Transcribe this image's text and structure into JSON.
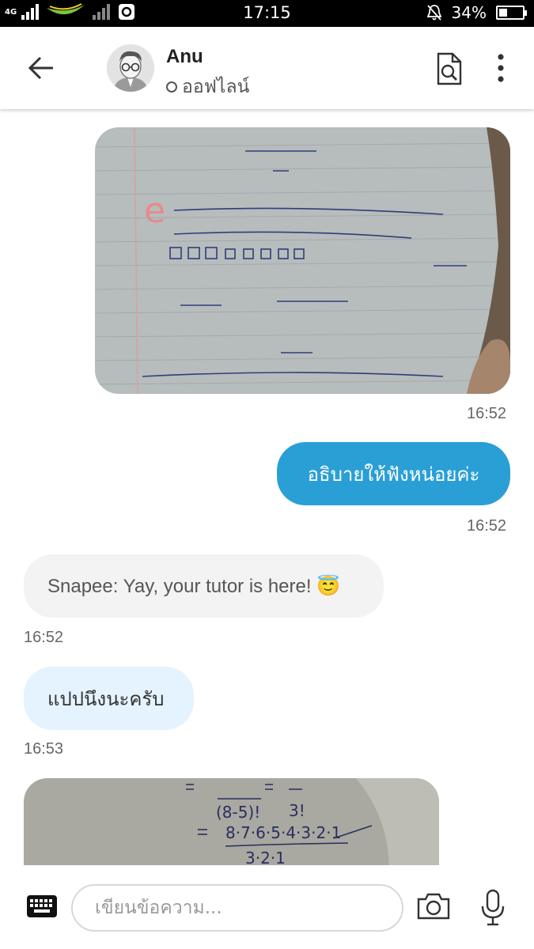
{
  "status_bar": {
    "network_type": "4G",
    "time": "17:15",
    "battery": "34%",
    "battery_level": 0.34
  },
  "header": {
    "back_icon": "arrow-left-icon",
    "contact_name": "Anu",
    "contact_status": "ออฟไลน์",
    "search_icon": "document-search-icon",
    "more_icon": "more-vertical-icon"
  },
  "messages": [
    {
      "type": "image",
      "direction": "outgoing",
      "time": "16:52"
    },
    {
      "type": "text",
      "direction": "outgoing",
      "text": "อธิบายให้ฟังหน่อยค่ะ",
      "time": "16:52"
    },
    {
      "type": "text",
      "direction": "system",
      "text": "Snapee: Yay, your tutor is here! 😇",
      "time": "16:52"
    },
    {
      "type": "text",
      "direction": "incoming",
      "text": "แปปนึงนะครับ",
      "time": "16:53"
    },
    {
      "type": "image",
      "direction": "incoming"
    }
  ],
  "composer": {
    "keyboard_icon": "keyboard-icon",
    "placeholder": "เขียนข้อความ...",
    "camera_icon": "camera-icon",
    "mic_icon": "microphone-icon"
  },
  "colors": {
    "outgoing_bubble": "#2a9fd6",
    "system_bubble": "#f3f3f3",
    "incoming_bubble": "#e4f3fd"
  }
}
